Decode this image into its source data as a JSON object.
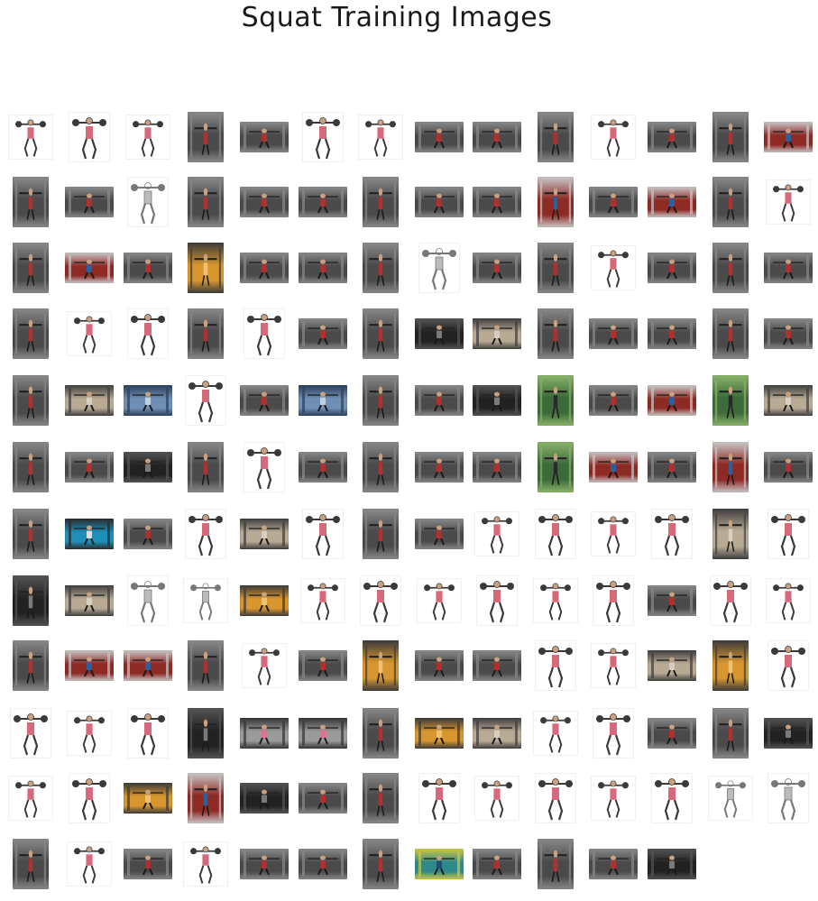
{
  "title": "Squat Training Images",
  "thumbnails": [
    [
      "white",
      "white",
      "white",
      "gym",
      "wide",
      "white",
      "white",
      "gym",
      "gym",
      "gym",
      "white",
      "gym",
      "gym",
      "red"
    ],
    [
      "gym",
      "gym",
      "sketch",
      "gym",
      "gym",
      "gym",
      "gym",
      "gym",
      "gym",
      "red",
      "gym",
      "red",
      "gym",
      "white"
    ],
    [
      "gym",
      "red",
      "gym",
      "orange",
      "gym",
      "gym",
      "gym",
      "sketch",
      "gym",
      "gym",
      "white",
      "gym",
      "gym",
      "gym"
    ],
    [
      "gym",
      "white",
      "white",
      "gym",
      "white",
      "gym",
      "gym",
      "dark",
      "tan",
      "gym",
      "gym",
      "gym",
      "gym",
      "gym"
    ],
    [
      "gym",
      "tan",
      "blue",
      "white",
      "gym",
      "blue",
      "gym",
      "gym",
      "dark",
      "green",
      "gym",
      "red",
      "green",
      "tan"
    ],
    [
      "gym",
      "gym",
      "dark",
      "gym",
      "white",
      "gym",
      "gym",
      "gym",
      "gym",
      "green",
      "red",
      "gym",
      "red",
      "gym"
    ],
    [
      "gym",
      "cyan",
      "gym",
      "white",
      "tan",
      "white",
      "gym",
      "gym",
      "white",
      "white",
      "white",
      "white",
      "tan",
      "white"
    ],
    [
      "dark",
      "tan",
      "sketch",
      "sketch",
      "orange",
      "white",
      "white",
      "white",
      "white",
      "white",
      "white",
      "gym",
      "white",
      "white"
    ],
    [
      "gym",
      "red",
      "red",
      "gym",
      "white",
      "gym",
      "orange",
      "gym",
      "gym",
      "white",
      "white",
      "tan",
      "orange",
      "white"
    ],
    [
      "white",
      "white",
      "white",
      "dark",
      "gray",
      "gray",
      "gym",
      "orange",
      "tan",
      "white",
      "white",
      "gym",
      "gym",
      "dark"
    ],
    [
      "white",
      "white",
      "orange",
      "red",
      "dark",
      "gym",
      "gym",
      "white",
      "white",
      "white",
      "white",
      "white",
      "sketch",
      "sketch"
    ],
    [
      "gym",
      "white",
      "gym",
      "white",
      "gym",
      "gym",
      "gym",
      "teal",
      "gym",
      "gym",
      "gym",
      "dark"
    ]
  ]
}
